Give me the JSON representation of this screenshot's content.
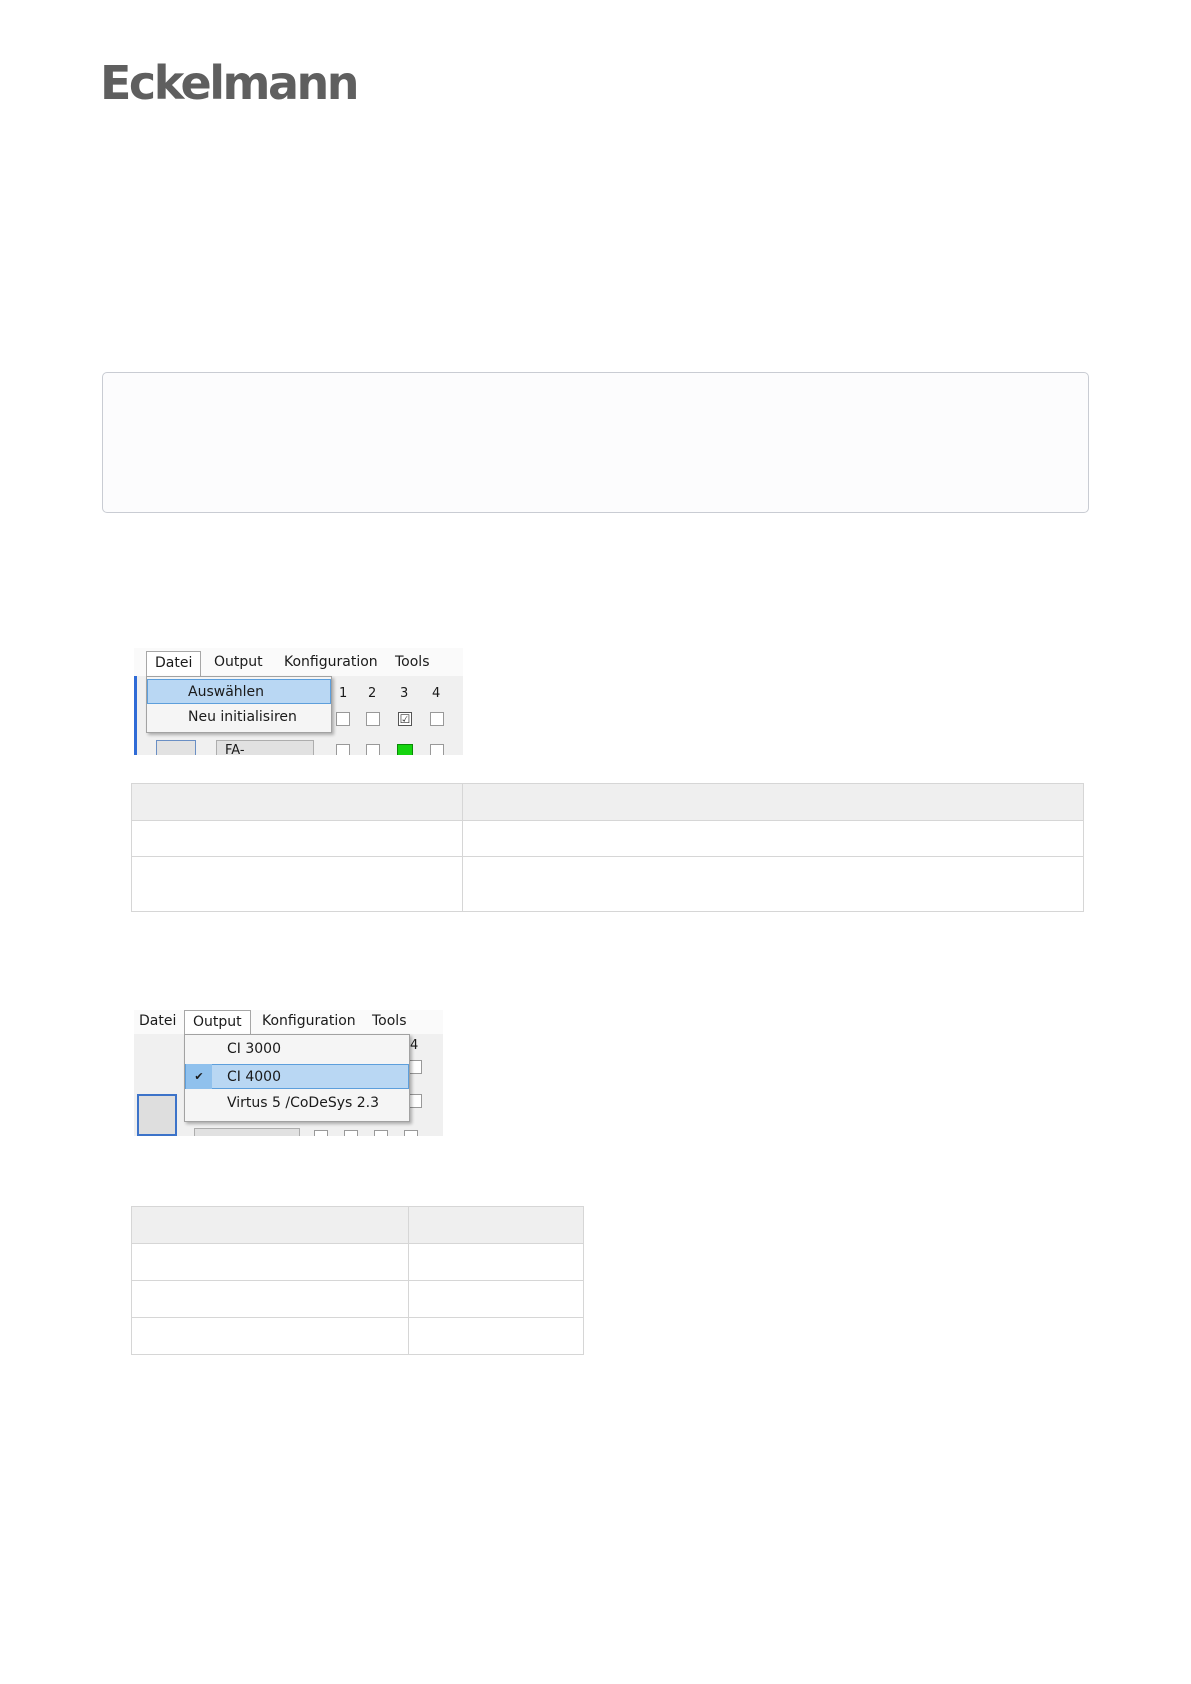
{
  "brand": {
    "logo_text": "Eckelmann"
  },
  "screenshot_file_menu": {
    "menu": [
      "Datei",
      "Output",
      "Konfiguration",
      "Tools"
    ],
    "dropdown_items": [
      "Auswählen",
      "Neu initialisiren"
    ],
    "selected_item": "Auswählen",
    "column_numbers": [
      "1",
      "2",
      "3",
      "4"
    ],
    "button_label": "FA-Zuordnung",
    "checkbox_checked": "☑",
    "active_indicator_color": "#15d40f"
  },
  "screenshot_output_menu": {
    "menu": [
      "Datei",
      "Output",
      "Konfiguration",
      "Tools"
    ],
    "dropdown_items": [
      "CI 3000",
      "CI 4000",
      "Virtus 5 /CoDeSys 2.3"
    ],
    "selected_item": "CI 4000",
    "check_mark": "✔",
    "column_number": "4"
  },
  "table1": {
    "columns": 2,
    "rows": 3
  },
  "table2": {
    "columns": 2,
    "rows": 4
  }
}
